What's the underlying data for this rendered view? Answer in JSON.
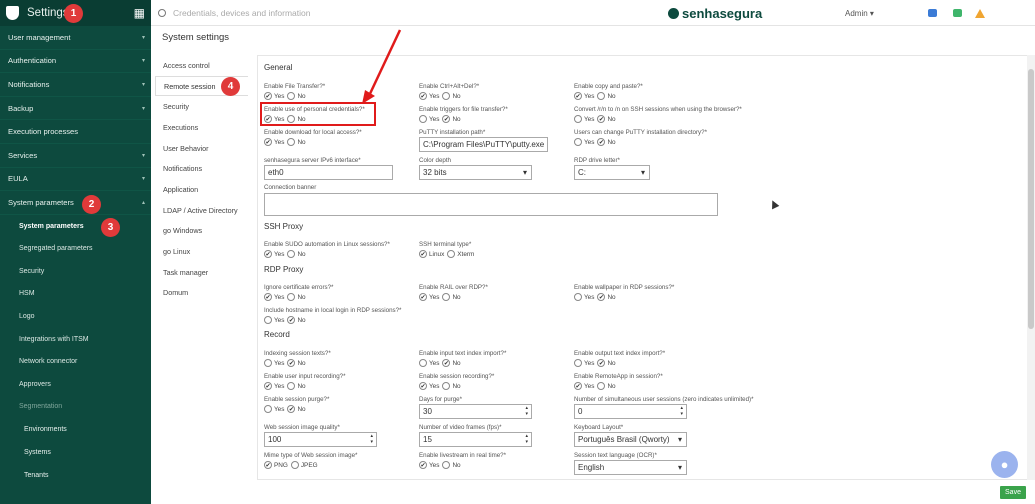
{
  "sidebar": {
    "title": "Settings",
    "items": [
      "User management",
      "Authentication",
      "Notifications",
      "Backup",
      "Execution processes",
      "Services",
      "EULA",
      "System parameters"
    ],
    "subitems": [
      "System parameters",
      "Segregated parameters",
      "Security",
      "HSM",
      "Logo",
      "Integrations with ITSM",
      "Network connector",
      "Approvers",
      "Segmentation"
    ],
    "subsub": [
      "Environments",
      "Systems",
      "Tenants"
    ]
  },
  "topbar": {
    "search_placeholder": "Credentials, devices and information",
    "brand": "senhasegura",
    "user": "Admin"
  },
  "page": {
    "title": "System settings"
  },
  "subnav": [
    "Access control",
    "Remote session",
    "Security",
    "Executions",
    "User Behavior",
    "Notifications",
    "Application",
    "LDAP / Active Directory",
    "go Windows",
    "go Linux",
    "Task manager",
    "Domum"
  ],
  "sections": {
    "general": "General",
    "ssh": "SSH Proxy",
    "rdp": "RDP Proxy",
    "record": "Record"
  },
  "labels": {
    "file_transfer": "Enable File Transfer?*",
    "ctrl_alt_del": "Enable Ctrl+Alt+Del?*",
    "copy_paste": "Enable copy and paste?*",
    "personal_cred": "Enable use of personal credentials?*",
    "triggers": "Enable triggers for file transfer?*",
    "convert_rn": "Convert /r/n to /n on SSH sessions when using the browser?*",
    "download_local": "Enable download for local access?*",
    "putty_path": "PuTTY installation path*",
    "users_putty": "Users can change PuTTY installation directory?*",
    "ipv6": "senhasegura server IPv6 interface*",
    "color_depth": "Color depth",
    "rdp_drive": "RDP drive letter*",
    "banner": "Connection banner",
    "sudo": "Enable SUDO automation in Linux sessions?*",
    "ssh_terminal": "SSH terminal type*",
    "ignore_cert": "Ignore certificate errors?*",
    "rail": "Enable RAIL over RDP?*",
    "wallpaper": "Enable wallpaper in RDP sessions?*",
    "hostname": "Include hostname in local login in RDP sessions?*",
    "indexing": "Indexing session texts?*",
    "input_index": "Enable input text index import?*",
    "output_index": "Enable output text index import?*",
    "user_input_rec": "Enable user input recording?*",
    "session_rec": "Enable session recording?*",
    "remoteapp": "Enable RemoteApp in session?*",
    "purge": "Enable session purge?*",
    "days_purge": "Days for purge*",
    "simul": "Number of simultaneous user sessions (zero indicates unlimited)*",
    "image_quality": "Web session image quality*",
    "fps": "Number of video frames (fps)*",
    "keyboard": "Keyboard Layout*",
    "mime": "Mime type of Web session image*",
    "livestream": "Enable livestream in real time?*",
    "ocr": "Session text language (OCR)*"
  },
  "opts": {
    "yes": "Yes",
    "no": "No",
    "linux": "Linux",
    "xterm": "Xterm",
    "png": "PNG",
    "jpeg": "JPEG"
  },
  "values": {
    "putty_path": "C:\\Program Files\\PuTTY\\putty.exe",
    "ipv6": "eth0",
    "color_depth": "32 bits",
    "rdp_drive": "C:",
    "days_purge": "30",
    "simul": "0",
    "image_quality": "100",
    "fps": "15",
    "keyboard": "Português Brasil (Qworty)",
    "ocr": "English"
  },
  "buttons": {
    "save": "Save"
  },
  "badges": [
    "1",
    "2",
    "3",
    "4"
  ],
  "colors": {
    "sidebar": "#0d4a3e",
    "save": "#3aa34b",
    "highlight": "#e01b1b"
  }
}
